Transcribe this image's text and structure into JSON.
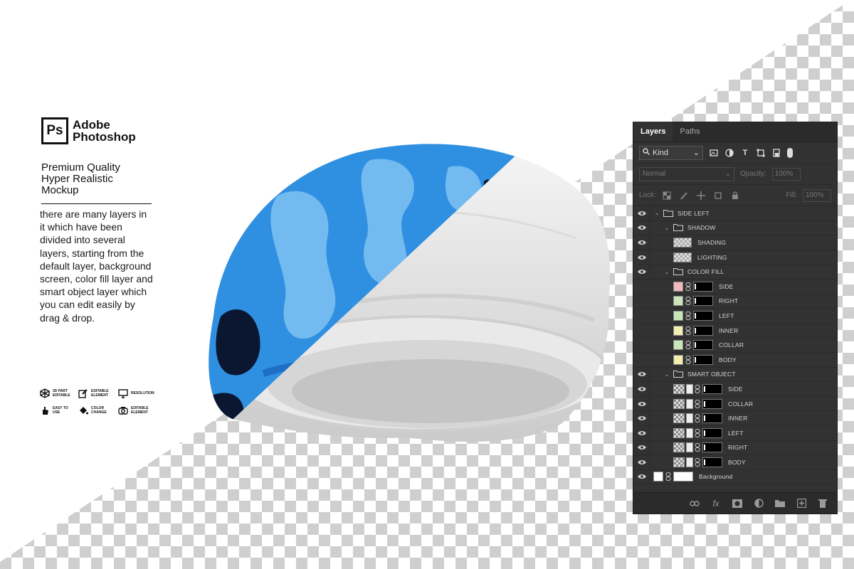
{
  "brand": {
    "logo_text": "Ps",
    "line1": "Adobe",
    "line2": "Photoshop"
  },
  "tagline": [
    "Premium Quality",
    "Hyper Realistic",
    "Mockup"
  ],
  "description": "there are many layers in it which have been divided into several layers, starting from the default layer, background screen, color fill layer and smart object layer which you can edit easily by drag & drop.",
  "features": [
    {
      "icon": "3d-part-icon",
      "label": "3D PART EDITABLE"
    },
    {
      "icon": "editable-element-icon",
      "label": "EDITABLE ELEMENT"
    },
    {
      "icon": "resolution-icon",
      "label": "RESOLUTION"
    },
    {
      "icon": "easy-to-use-icon",
      "label": "EASY TO USE"
    },
    {
      "icon": "color-change-icon",
      "label": "COLOR CHANGE"
    },
    {
      "icon": "camera-icon",
      "label": "EDITABLE ELEMENT"
    }
  ],
  "panel": {
    "tabs": [
      "Layers",
      "Paths"
    ],
    "kind_label": "Kind",
    "blend_mode": "Normal",
    "opacity_label": "Opacity:",
    "opacity_value": "100%",
    "lock_label": "Lock:",
    "fill_label": "Fill:",
    "fill_value": "100%",
    "layers": [
      {
        "name": "SIDE LEFT",
        "type": "group",
        "indent": 0,
        "visible": true
      },
      {
        "name": "SHADOW",
        "type": "group",
        "indent": 1,
        "visible": true
      },
      {
        "name": "SHADING",
        "type": "pixel",
        "indent": 2,
        "visible": true
      },
      {
        "name": "LIGHTING",
        "type": "pixel",
        "indent": 2,
        "visible": true
      },
      {
        "name": "COLOR FILL",
        "type": "group",
        "indent": 1,
        "visible": true
      },
      {
        "name": "SIDE",
        "type": "fill",
        "indent": 2,
        "visible": false,
        "color": "#f2b8bd"
      },
      {
        "name": "RIGHT",
        "type": "fill",
        "indent": 2,
        "visible": false,
        "color": "#c9e6b8"
      },
      {
        "name": "LEFT",
        "type": "fill",
        "indent": 2,
        "visible": false,
        "color": "#c9e6b8"
      },
      {
        "name": "INNER",
        "type": "fill",
        "indent": 2,
        "visible": false,
        "color": "#f4eeb0"
      },
      {
        "name": "COLLAR",
        "type": "fill",
        "indent": 2,
        "visible": false,
        "color": "#c9e6b8"
      },
      {
        "name": "BODY",
        "type": "fill",
        "indent": 2,
        "visible": false,
        "color": "#f4eeb0"
      },
      {
        "name": "SMART OBJECT",
        "type": "group",
        "indent": 1,
        "visible": true
      },
      {
        "name": "SIDE",
        "type": "smart",
        "indent": 2,
        "visible": true
      },
      {
        "name": "COLLAR",
        "type": "smart",
        "indent": 2,
        "visible": true
      },
      {
        "name": "INNER",
        "type": "smart",
        "indent": 2,
        "visible": true
      },
      {
        "name": "LEFT",
        "type": "smart",
        "indent": 2,
        "visible": true
      },
      {
        "name": "RIGHT",
        "type": "smart",
        "indent": 2,
        "visible": true
      },
      {
        "name": "BODY",
        "type": "smart",
        "indent": 2,
        "visible": true
      },
      {
        "name": "Background",
        "type": "background",
        "indent": 0,
        "visible": true
      }
    ],
    "footer_icons": [
      "link-icon",
      "fx-icon",
      "mask-icon",
      "adjustment-icon",
      "folder-icon",
      "new-layer-icon",
      "trash-icon"
    ]
  },
  "colors": {
    "hat_blue": "#2f8fe0",
    "hat_light_blue": "#7fc2f2",
    "hat_dark": "#0b1630",
    "panel_bg": "#323232"
  }
}
